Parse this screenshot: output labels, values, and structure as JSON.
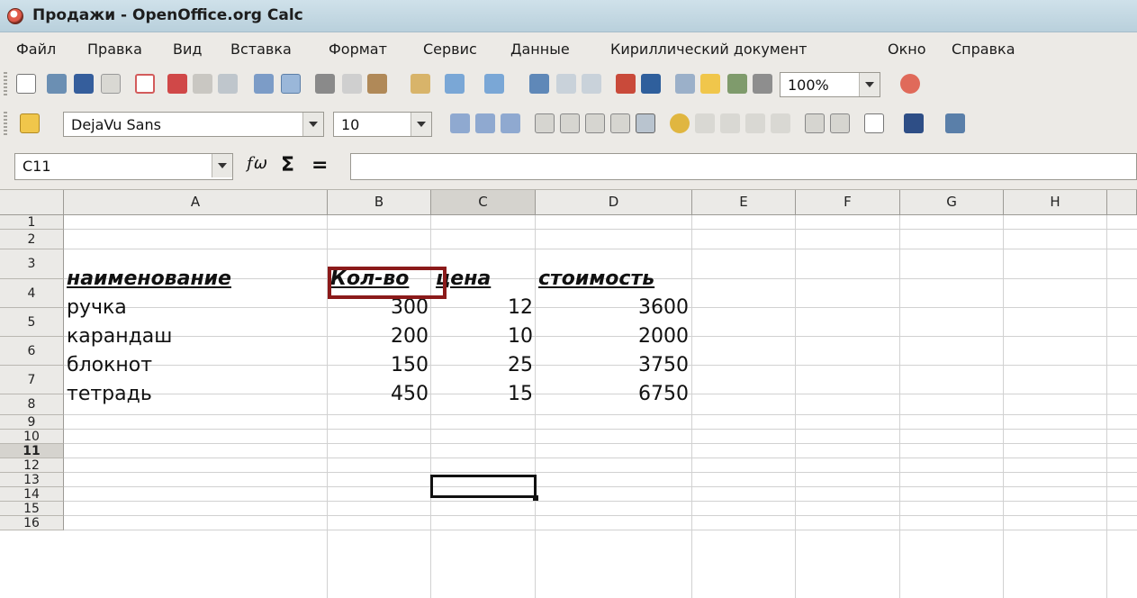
{
  "window": {
    "title": "Продажи - OpenOffice.org Calc"
  },
  "menu": [
    "Файл",
    "Правка",
    "Вид",
    "Вставка",
    "Формат",
    "Сервис",
    "Данные",
    "Кириллический документ",
    "Окно",
    "Справка"
  ],
  "toolbar": {
    "zoom": "100%"
  },
  "formatting": {
    "font_name": "DejaVu Sans",
    "font_size": "10"
  },
  "formula_bar": {
    "cell_ref": "C11",
    "fx_symbol": "f⍵",
    "sum_symbol": "Σ",
    "equals_symbol": "=",
    "content": ""
  },
  "columns": [
    "A",
    "B",
    "C",
    "D",
    "E",
    "F",
    "G",
    "H"
  ],
  "rows": [
    "1",
    "2",
    "3",
    "4",
    "5",
    "6",
    "7",
    "8",
    "9",
    "10",
    "11",
    "12",
    "13",
    "14",
    "15",
    "16"
  ],
  "sheet": {
    "header": {
      "name": "наименование",
      "qty": "Кол-во",
      "price": "цена",
      "cost": "стоимость"
    },
    "items": [
      {
        "name": "ручка",
        "qty": "300",
        "price": "12",
        "cost": "3600"
      },
      {
        "name": "карандаш",
        "qty": "200",
        "price": "10",
        "cost": "2000"
      },
      {
        "name": "блокнот",
        "qty": "150",
        "price": "25",
        "cost": "3750"
      },
      {
        "name": "тетрадь",
        "qty": "450",
        "price": "15",
        "cost": "6750"
      }
    ]
  },
  "selection": {
    "active_cell": "C11",
    "active_row": "11",
    "active_column": "C"
  },
  "colors": {
    "highlight_box": "#8b1a1a",
    "header_bg": "#ebeae7",
    "header_selected_bg": "#d5d3ce",
    "toolbar_bg": "#eceae6"
  }
}
